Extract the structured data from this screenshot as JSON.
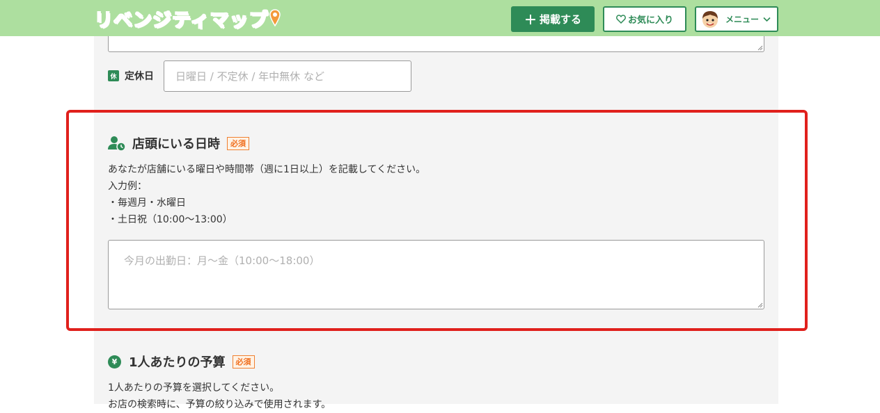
{
  "header": {
    "logo_text": "リベンジティマップ",
    "post_button": "掲載する",
    "post_plus": "＋",
    "favorites_button": "お気に入り",
    "menu_button": "メニュー"
  },
  "form": {
    "closed_days": {
      "icon_char": "休",
      "label": "定休日",
      "placeholder": "日曜日 / 不定休 / 年中無休 など"
    },
    "time_at_store": {
      "title": "店頭にいる日時",
      "required_badge": "必須",
      "description_lines": [
        "あなたが店舗にいる曜日や時間帯（週に1日以上）を記載してください。",
        "入力例：",
        "・毎週月・水曜日",
        "・土日祝（10:00〜13:00）"
      ],
      "placeholder": "今月の出勤日：月〜金（10:00〜18:00）"
    },
    "budget": {
      "icon_char": "¥",
      "title": "1人あたりの予算",
      "required_badge": "必須",
      "description_lines": [
        "1人あたりの予算を選択してください。",
        "お店の検索時に、予算の絞り込みで使用されます。"
      ]
    }
  },
  "colors": {
    "header_bg": "#addf9f",
    "brand_green": "#2e8b57",
    "highlight_red": "#e0201c",
    "required_orange": "#f07020"
  }
}
